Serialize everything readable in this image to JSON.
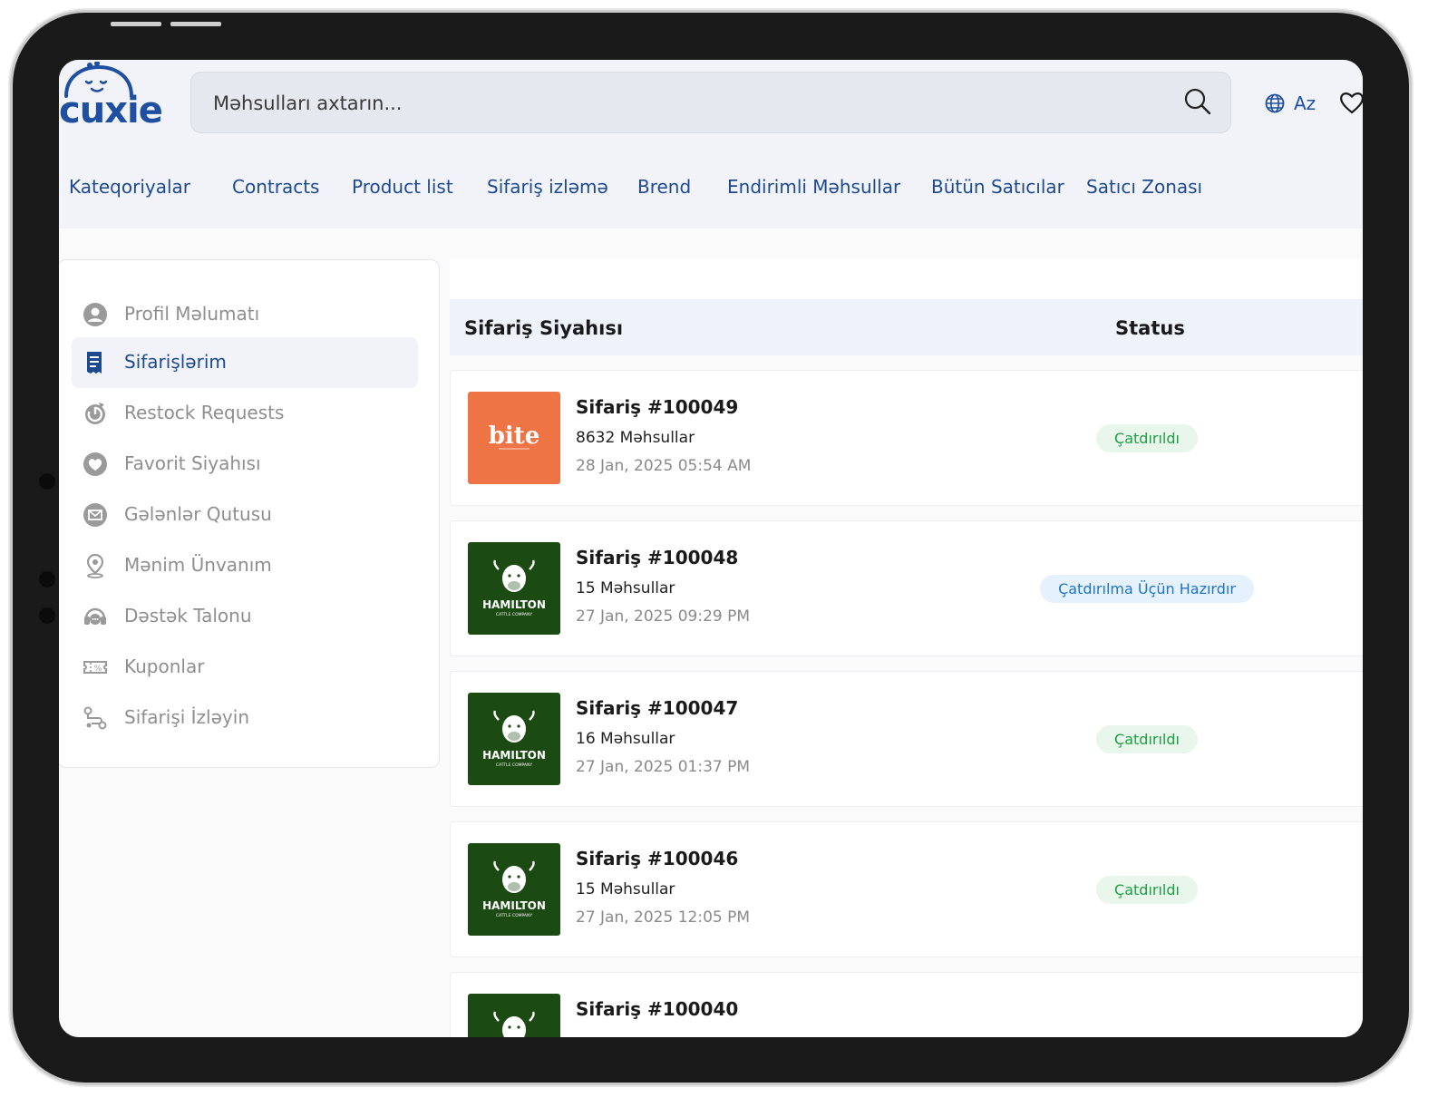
{
  "brand": {
    "logo_text": "cuxie"
  },
  "search": {
    "placeholder": "Məhsulları axtarın..."
  },
  "header": {
    "language": "Az"
  },
  "nav": [
    "Kateqoriyalar",
    "Contracts",
    "Product list",
    "Sifariş izləmə",
    "Brend",
    "Endirimli Məhsullar",
    "Bütün Satıcılar",
    "Satıcı Zonası"
  ],
  "sidebar": {
    "active_index": 1,
    "items": [
      {
        "label": "Profil Məlumatı",
        "icon": "user-circle-icon"
      },
      {
        "label": "Sifarişlərim",
        "icon": "receipt-icon"
      },
      {
        "label": "Restock Requests",
        "icon": "restock-icon"
      },
      {
        "label": "Favorit Siyahısı",
        "icon": "heart-icon"
      },
      {
        "label": "Gələnlər Qutusu",
        "icon": "mail-icon"
      },
      {
        "label": "Mənim Ünvanım",
        "icon": "location-pin-icon"
      },
      {
        "label": "Dəstək Talonu",
        "icon": "headset-icon"
      },
      {
        "label": "Kuponlar",
        "icon": "coupon-icon"
      },
      {
        "label": "Sifarişi İzləyin",
        "icon": "route-icon"
      }
    ]
  },
  "orders_table": {
    "title": "Sifariş Siyahısı",
    "status_header": "Status",
    "orders": [
      {
        "number": "Sifariş #100049",
        "items": "8632 Məhsullar",
        "date": "28 Jan, 2025 05:54 AM",
        "status": "Çatdırıldı",
        "status_type": "green",
        "vendor_logo": "bite",
        "vendor_text": "bite"
      },
      {
        "number": "Sifariş #100048",
        "items": "15 Məhsullar",
        "date": "27 Jan, 2025 09:29 PM",
        "status": "Çatdırılma Üçün Hazırdır",
        "status_type": "blue",
        "vendor_logo": "hamilton",
        "vendor_text": "HAMILTON",
        "vendor_subtext": "CATTLE COMPANY"
      },
      {
        "number": "Sifariş #100047",
        "items": "16 Məhsullar",
        "date": "27 Jan, 2025 01:37 PM",
        "status": "Çatdırıldı",
        "status_type": "green",
        "vendor_logo": "hamilton",
        "vendor_text": "HAMILTON",
        "vendor_subtext": "CATTLE COMPANY"
      },
      {
        "number": "Sifariş #100046",
        "items": "15 Məhsullar",
        "date": "27 Jan, 2025 12:05 PM",
        "status": "Çatdırıldı",
        "status_type": "green",
        "vendor_logo": "hamilton",
        "vendor_text": "HAMILTON",
        "vendor_subtext": "CATTLE COMPANY"
      },
      {
        "number": "Sifariş #100040",
        "items": "",
        "date": "",
        "status": "",
        "status_type": "green",
        "vendor_logo": "hamilton",
        "vendor_text": "",
        "vendor_subtext": ""
      }
    ]
  },
  "colors": {
    "brand_blue": "#1f4fa0",
    "nav_text": "#1d4a8f",
    "header_bg": "#f1f3f9",
    "bite_orange": "#ee7445",
    "hamilton_green": "#1b4a12",
    "status_green": "#1e9e43",
    "status_blue": "#1f73c8"
  }
}
